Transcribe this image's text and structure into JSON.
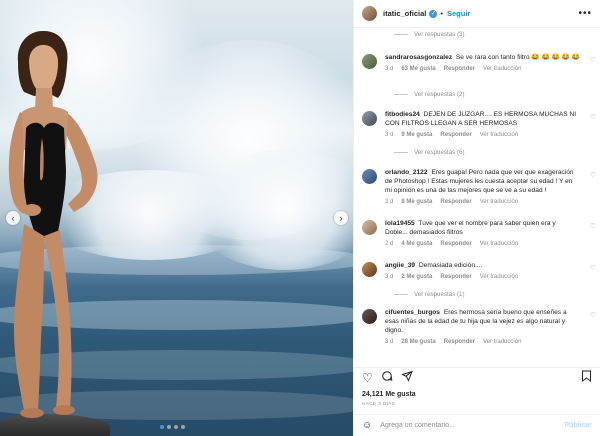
{
  "post": {
    "username": "itatic_oficial",
    "follow_label": "Seguir",
    "more_label": "•••"
  },
  "comments": [
    {
      "type": "replies",
      "label": "Ver respuestas (3)"
    },
    {
      "type": "comment",
      "user": "sandrarosasgonzalez",
      "text": "Se ve rara con tanto filtro 😂 😂 😂 😂 😂",
      "time": "3 d",
      "likes": "63 Me gusta",
      "reply": "Responder",
      "translate": "Ver traducción"
    },
    {
      "type": "replies",
      "label": "Ver respuestas (2)"
    },
    {
      "type": "comment",
      "user": "fitbodies24",
      "text": "DEJEN DE JUZGAR.... ES HERMOSA MUCHAS NI CON FILTROS LLEGAN A SER HERMOSAS",
      "time": "3 d",
      "likes": "9 Me gusta",
      "reply": "Responder",
      "translate": "Ver traducción"
    },
    {
      "type": "replies",
      "label": "Ver respuestas (6)"
    },
    {
      "type": "comment",
      "user": "orlando_2122",
      "text": "Eres guapa! Pero nada que ver que exageración de Photoshop ! Estas mujeres les cuesta aceptar su edad ! Y en mi opinión es una de las mejores que se ve a su edad !",
      "time": "3 d",
      "likes": "8 Me gusta",
      "reply": "Responder",
      "translate": "Ver traducción"
    },
    {
      "type": "comment",
      "user": "lola19455",
      "text": "Tuve que ver el nombre para saber quien era y Doble... demasiados filtros",
      "time": "2 d",
      "likes": "4 Me gusta",
      "reply": "Responder",
      "translate": "Ver traducción"
    },
    {
      "type": "comment",
      "user": "angiie_39",
      "text": "Demasiada edición....",
      "time": "3 d",
      "likes": "2 Me gusta",
      "reply": "Responder",
      "translate": "Ver traducción"
    },
    {
      "type": "replies",
      "label": "Ver respuestas (1)"
    },
    {
      "type": "comment",
      "user": "cifuentes_burgos",
      "text": "Eres hermosa sería bueno que enseñes a esas niñas de la edad de tu hija que la vejez es algo natural y digno.",
      "time": "3 d",
      "likes": "28 Me gusta",
      "reply": "Responder",
      "translate": "Ver traducción"
    }
  ],
  "footer": {
    "likes": "24,121 Me gusta",
    "ago": "HACE 3 DÍAS",
    "add_comment_placeholder": "Agrega un comentario...",
    "publish_label": "Publicar"
  },
  "colors": {
    "accent": "#0095f6",
    "verified": "#3897f0",
    "muted": "#8e8e8e"
  },
  "icons": [
    "verified-icon",
    "heart-icon",
    "comment-icon",
    "share-icon",
    "bookmark-icon",
    "emoji-icon",
    "chevron-left-icon",
    "chevron-right-icon"
  ]
}
